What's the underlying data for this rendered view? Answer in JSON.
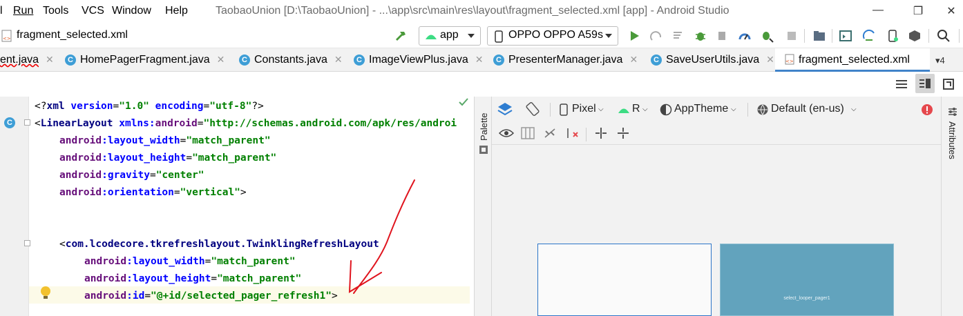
{
  "menu": {
    "items": [
      "Run",
      "Tools",
      "VCS",
      "Window",
      "Help"
    ],
    "first_partial": "l"
  },
  "window": {
    "title": "TaobaoUnion [D:\\TaobaoUnion] - ...\\app\\src\\main\\res\\layout\\fragment_selected.xml [app] - Android Studio",
    "min_label": "—",
    "max_label": "❐",
    "close_label": "✕"
  },
  "toolbar": {
    "file_name": "fragment_selected.xml",
    "run_config": "app",
    "device": "OPPO OPPO A59s"
  },
  "tabs": [
    {
      "label": "ent.java",
      "active": false,
      "icon": ""
    },
    {
      "label": "HomePagerFragment.java",
      "active": false,
      "icon": "C"
    },
    {
      "label": "Constants.java",
      "active": false,
      "icon": "C"
    },
    {
      "label": "ImageViewPlus.java",
      "active": false,
      "icon": "C"
    },
    {
      "label": "PresenterManager.java",
      "active": false,
      "icon": "C"
    },
    {
      "label": "SaveUserUtils.java",
      "active": false,
      "icon": "C"
    },
    {
      "label": "fragment_selected.xml",
      "active": true,
      "icon": "xml"
    }
  ],
  "tab_overflow": "▾4",
  "editor": {
    "lines": [
      "<?xml version=\"1.0\" encoding=\"utf-8\"?>",
      "<LinearLayout xmlns:android=\"http://schemas.android.com/apk/res/androi",
      "android:layout_width=\"match_parent\"",
      "android:layout_height=\"match_parent\"",
      "android:gravity=\"center\"",
      "android:orientation=\"vertical\">",
      "",
      "",
      "<com.lcodecore.tkrefreshlayout.TwinklingRefreshLayout",
      "android:layout_width=\"match_parent\"",
      "android:layout_height=\"match_parent\"",
      "android:id=\"@+id/selected_pager_refresh1\">"
    ]
  },
  "design": {
    "palette_label": "Palette",
    "attributes_label": "Attributes",
    "device_label": "Pixel",
    "api_label": "R",
    "theme_label": "AppTheme",
    "locale_label": "Default (en-us)",
    "preview_blue_text": "select_looper_pager1"
  },
  "colors": {
    "tab_accent": "#4083c9",
    "preview_blue": "#62a3bd",
    "error_red": "#e5484d",
    "annotation_red": "#e0141e"
  }
}
